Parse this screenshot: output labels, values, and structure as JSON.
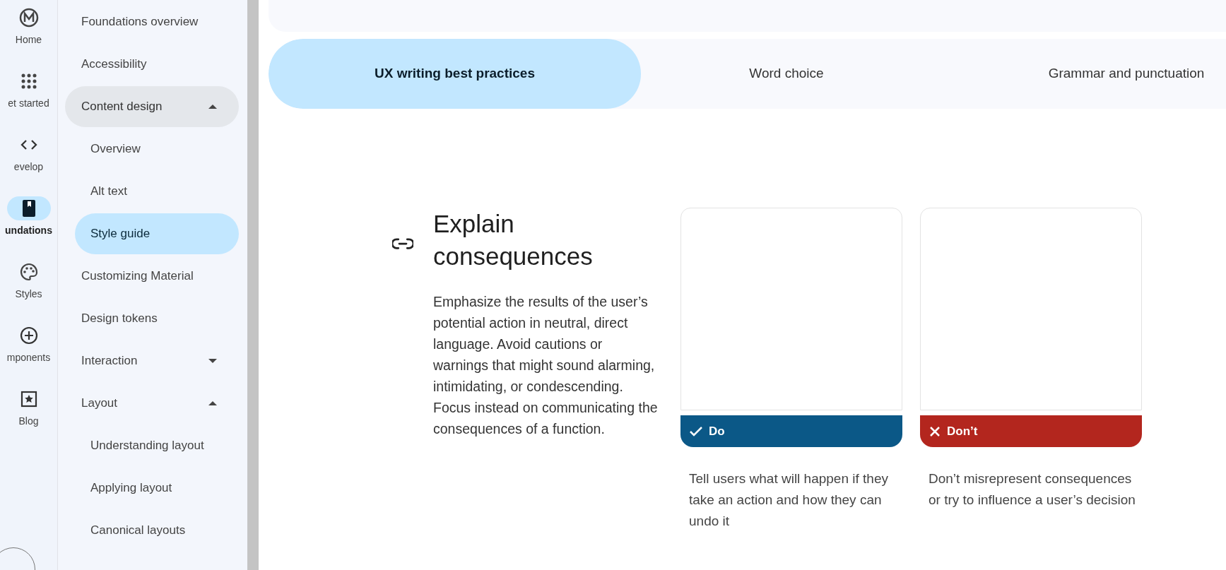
{
  "rail": [
    {
      "label": "Home",
      "selected": false
    },
    {
      "label": "et started",
      "selected": false
    },
    {
      "label": "evelop",
      "selected": false
    },
    {
      "label": "undations",
      "selected": true
    },
    {
      "label": "Styles",
      "selected": false
    },
    {
      "label": "mponents",
      "selected": false
    },
    {
      "label": "Blog",
      "selected": false
    }
  ],
  "sidebar": {
    "items": [
      {
        "label": "Foundations overview",
        "selected": false
      },
      {
        "label": "Accessibility",
        "selected": false
      },
      {
        "label": "Content design",
        "selected": false,
        "hovered": true,
        "expanded": true,
        "children": [
          {
            "label": "Overview",
            "selected": false
          },
          {
            "label": "Alt text",
            "selected": false
          },
          {
            "label": "Style guide",
            "selected": true
          }
        ]
      },
      {
        "label": "Customizing Material",
        "selected": false
      },
      {
        "label": "Design tokens",
        "selected": false
      },
      {
        "label": "Interaction",
        "selected": false,
        "expanded": false
      },
      {
        "label": "Layout",
        "selected": false,
        "expanded": true,
        "children": [
          {
            "label": "Understanding layout",
            "selected": false
          },
          {
            "label": "Applying layout",
            "selected": false
          },
          {
            "label": "Canonical layouts",
            "selected": false
          }
        ]
      }
    ]
  },
  "tabs": [
    {
      "label": "UX writing best practices",
      "selected": true
    },
    {
      "label": "Word choice",
      "selected": false
    },
    {
      "label": "Grammar and punctuation",
      "selected": false
    }
  ],
  "section": {
    "title": "Explain consequences",
    "body": "Emphasize the results of the user’s potential action in neutral, direct language. Avoid cautions or warnings that might sound alarming, intimidating, or condescending. Focus instead on communicating the consequences of a function.",
    "examples": [
      {
        "kind": "do",
        "label": "Do",
        "caption": "Tell users what will happen if they take an action and how they can undo it"
      },
      {
        "kind": "dont",
        "label": "Don’t",
        "caption": "Don’t misrepresent consequences or try to influence a user’s decision"
      }
    ]
  }
}
